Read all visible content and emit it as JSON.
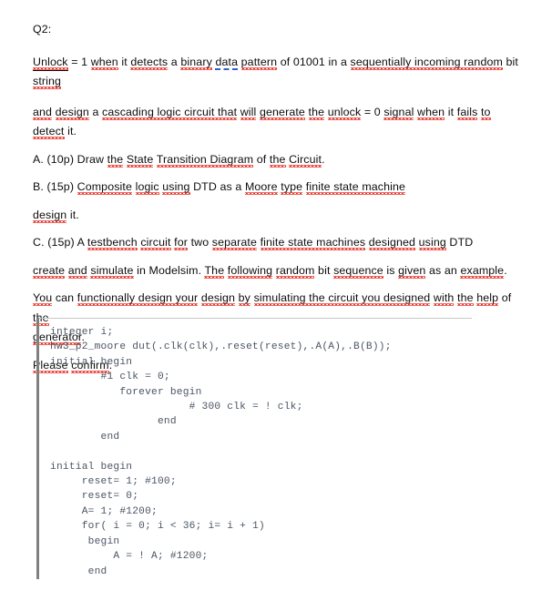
{
  "document": {
    "question_label": "Q2:",
    "paragraphs": [
      {
        "id": "p-unlock",
        "runs": [
          {
            "text": "Unlock",
            "style": "sp ul"
          },
          {
            "text": " = 1 ",
            "style": ""
          },
          {
            "text": "when",
            "style": "sp"
          },
          {
            "text": " it ",
            "style": ""
          },
          {
            "text": "detects",
            "style": "sp"
          },
          {
            "text": " a ",
            "style": ""
          },
          {
            "text": "binary",
            "style": "sp"
          },
          {
            "text": " ",
            "style": ""
          },
          {
            "text": "data",
            "style": "gr"
          },
          {
            "text": " ",
            "style": ""
          },
          {
            "text": "pattern",
            "style": "sp"
          },
          {
            "text": " of 01001 in a ",
            "style": ""
          },
          {
            "text": "sequentially incoming random",
            "style": "sp"
          },
          {
            "text": " bit",
            "style": ""
          }
        ]
      },
      {
        "id": "p-string",
        "runs": [
          {
            "text": "string",
            "style": "sp"
          }
        ]
      },
      {
        "id": "p-and-design",
        "runs": [
          {
            "text": "and",
            "style": "sp"
          },
          {
            "text": " ",
            "style": ""
          },
          {
            "text": "design",
            "style": "sp"
          },
          {
            "text": " a ",
            "style": ""
          },
          {
            "text": "cascading logic circuit that",
            "style": "sp"
          },
          {
            "text": " ",
            "style": ""
          },
          {
            "text": "will",
            "style": "sp"
          },
          {
            "text": " ",
            "style": ""
          },
          {
            "text": "generate",
            "style": "sp"
          },
          {
            "text": " ",
            "style": ""
          },
          {
            "text": "the",
            "style": "sp"
          },
          {
            "text": " ",
            "style": ""
          },
          {
            "text": "unlock",
            "style": "sp"
          },
          {
            "text": " = 0 ",
            "style": ""
          },
          {
            "text": "signal",
            "style": "sp"
          },
          {
            "text": " ",
            "style": ""
          },
          {
            "text": "when",
            "style": "sp"
          },
          {
            "text": " it ",
            "style": ""
          },
          {
            "text": "fails",
            "style": "sp"
          },
          {
            "text": " ",
            "style": ""
          },
          {
            "text": "to",
            "style": "sp"
          },
          {
            "text": " ",
            "style": ""
          },
          {
            "text": "detect",
            "style": "sp"
          },
          {
            "text": " it.",
            "style": ""
          }
        ]
      },
      {
        "id": "p-a",
        "runs": [
          {
            "text": "A. (10p) Draw ",
            "style": ""
          },
          {
            "text": "the",
            "style": "sp"
          },
          {
            "text": " ",
            "style": ""
          },
          {
            "text": "State",
            "style": "sp"
          },
          {
            "text": " ",
            "style": ""
          },
          {
            "text": "Transition Diagram",
            "style": "sp"
          },
          {
            "text": " of ",
            "style": ""
          },
          {
            "text": "the",
            "style": "sp"
          },
          {
            "text": " ",
            "style": ""
          },
          {
            "text": "Circuit",
            "style": "sp"
          },
          {
            "text": ".",
            "style": ""
          }
        ]
      },
      {
        "id": "p-b",
        "runs": [
          {
            "text": "B. (15p) ",
            "style": ""
          },
          {
            "text": "Composite",
            "style": "sp"
          },
          {
            "text": " ",
            "style": ""
          },
          {
            "text": "logic",
            "style": "sp"
          },
          {
            "text": " ",
            "style": ""
          },
          {
            "text": "using",
            "style": "sp"
          },
          {
            "text": " DTD as a ",
            "style": ""
          },
          {
            "text": "Moore",
            "style": "sp"
          },
          {
            "text": " ",
            "style": ""
          },
          {
            "text": "type",
            "style": "sp"
          },
          {
            "text": " ",
            "style": ""
          },
          {
            "text": "finite state machine",
            "style": "sp"
          }
        ]
      },
      {
        "id": "p-design-it",
        "runs": [
          {
            "text": "design",
            "style": "sp"
          },
          {
            "text": " it.",
            "style": ""
          }
        ]
      },
      {
        "id": "p-c",
        "runs": [
          {
            "text": "C. (15p) A ",
            "style": ""
          },
          {
            "text": "testbench",
            "style": "sp"
          },
          {
            "text": " ",
            "style": ""
          },
          {
            "text": "circuit",
            "style": "sp"
          },
          {
            "text": " ",
            "style": ""
          },
          {
            "text": "for",
            "style": "sp"
          },
          {
            "text": " two ",
            "style": ""
          },
          {
            "text": "separate",
            "style": "sp"
          },
          {
            "text": " ",
            "style": ""
          },
          {
            "text": "finite state machines",
            "style": "sp"
          },
          {
            "text": " ",
            "style": ""
          },
          {
            "text": "designed",
            "style": "sp"
          },
          {
            "text": " ",
            "style": ""
          },
          {
            "text": "using",
            "style": "sp"
          },
          {
            "text": " DTD",
            "style": ""
          }
        ]
      },
      {
        "id": "p-create",
        "runs": [
          {
            "text": "create",
            "style": "sp"
          },
          {
            "text": " ",
            "style": ""
          },
          {
            "text": "and",
            "style": "sp"
          },
          {
            "text": " ",
            "style": ""
          },
          {
            "text": "simulate",
            "style": "sp"
          },
          {
            "text": " in Modelsim. ",
            "style": ""
          },
          {
            "text": "The",
            "style": "sp"
          },
          {
            "text": " ",
            "style": ""
          },
          {
            "text": "following",
            "style": "sp"
          },
          {
            "text": " ",
            "style": ""
          },
          {
            "text": "random",
            "style": "sp"
          },
          {
            "text": " bit ",
            "style": ""
          },
          {
            "text": "sequence",
            "style": "sp"
          },
          {
            "text": " is ",
            "style": ""
          },
          {
            "text": "given",
            "style": "sp"
          },
          {
            "text": " as an ",
            "style": ""
          },
          {
            "text": "example",
            "style": "sp"
          },
          {
            "text": ".",
            "style": ""
          }
        ]
      },
      {
        "id": "p-you-can",
        "runs": [
          {
            "text": "You",
            "style": "sp"
          },
          {
            "text": " can ",
            "style": ""
          },
          {
            "text": "functionally design your",
            "style": "sp"
          },
          {
            "text": " ",
            "style": ""
          },
          {
            "text": "design",
            "style": "sp"
          },
          {
            "text": " ",
            "style": ""
          },
          {
            "text": "by",
            "style": "sp"
          },
          {
            "text": " ",
            "style": ""
          },
          {
            "text": "simulating the circuit you designed",
            "style": "sp"
          },
          {
            "text": " ",
            "style": ""
          },
          {
            "text": "with",
            "style": "sp"
          },
          {
            "text": " ",
            "style": ""
          },
          {
            "text": "the",
            "style": "sp"
          },
          {
            "text": " ",
            "style": ""
          },
          {
            "text": "help",
            "style": "sp"
          },
          {
            "text": " of ",
            "style": ""
          },
          {
            "text": "the",
            "style": "sp"
          }
        ]
      },
      {
        "id": "p-generator",
        "runs": [
          {
            "text": "generator",
            "style": "sp"
          },
          {
            "text": ".",
            "style": ""
          }
        ]
      },
      {
        "id": "p-please-confirm",
        "runs": [
          {
            "text": "Please",
            "style": "sp"
          },
          {
            "text": " ",
            "style": ""
          },
          {
            "text": "confirm",
            "style": "sp"
          },
          {
            "text": ".",
            "style": ""
          }
        ]
      }
    ]
  },
  "code_block": {
    "language": "verilog",
    "text": "integer i;\nhw3_p2_moore dut(.clk(clk),.reset(reset),.A(A),.B(B));\ninitial begin\n        #1 clk = 0;\n           forever begin\n                      # 300 clk = ! clk;\n                 end\n        end\n\ninitial begin\n     reset= 1; #100;\n     reset= 0;\n     A= 1; #1200;\n     for( i = 0; i < 36; i= i + 1)\n      begin\n          A = ! A; #1200;\n      end"
  },
  "colors": {
    "text": "#0d0d0d",
    "code_text": "#4b5563",
    "spellcheck_underline": "#e8352c",
    "grammar_underline": "#2f5fd0",
    "code_border": "#808080",
    "code_rule": "#c8c8c8",
    "page_background": "#ffffff"
  }
}
